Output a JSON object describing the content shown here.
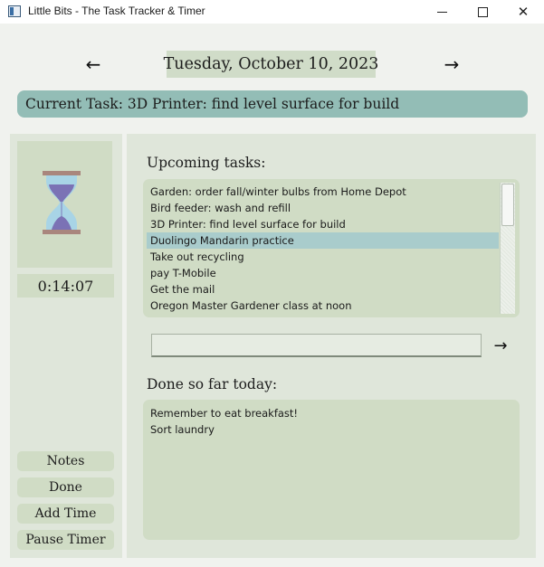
{
  "window": {
    "title": "Little Bits - The Task Tracker & Timer",
    "icon": "app-window-icon",
    "controls": [
      "minimize-icon",
      "maximize-icon",
      "close-icon"
    ]
  },
  "date_nav": {
    "prev_label": "←",
    "next_label": "→",
    "date": "Tuesday, October 10, 2023"
  },
  "current_task": {
    "text": "Current Task: 3D Printer: find level surface for build"
  },
  "timer": {
    "icon": "hourglass-icon",
    "elapsed": "0:14:07"
  },
  "actions": {
    "notes": "Notes",
    "done": "Done",
    "add_time": "Add Time",
    "pause_timer": "Pause Timer"
  },
  "upcoming": {
    "label": "Upcoming tasks:",
    "items": [
      "Garden: order fall/winter bulbs from Home Depot",
      "Bird feeder: wash and refill",
      "3D Printer: find level surface for build",
      "Duolingo Mandarin practice",
      "Take out recycling",
      "pay T-Mobile",
      "Get the mail",
      "Oregon Master Gardener class at noon"
    ],
    "selected_index": 3
  },
  "new_task": {
    "value": "",
    "add_label": "→"
  },
  "done_today": {
    "label": "Done so far today:",
    "items": [
      "Remember to eat breakfast!",
      "Sort laundry"
    ]
  },
  "colors": {
    "date_bg": "#d0dcc8",
    "current_task_bg": "#93bdb6",
    "panel_bg": "#dfe6da",
    "box_bg": "#d0dcc5",
    "selected_row": "#a9cccc",
    "hourglass_frame": "#a9867d",
    "hourglass_sand": "#7b72b5",
    "hourglass_glass": "#a8d4e6"
  }
}
